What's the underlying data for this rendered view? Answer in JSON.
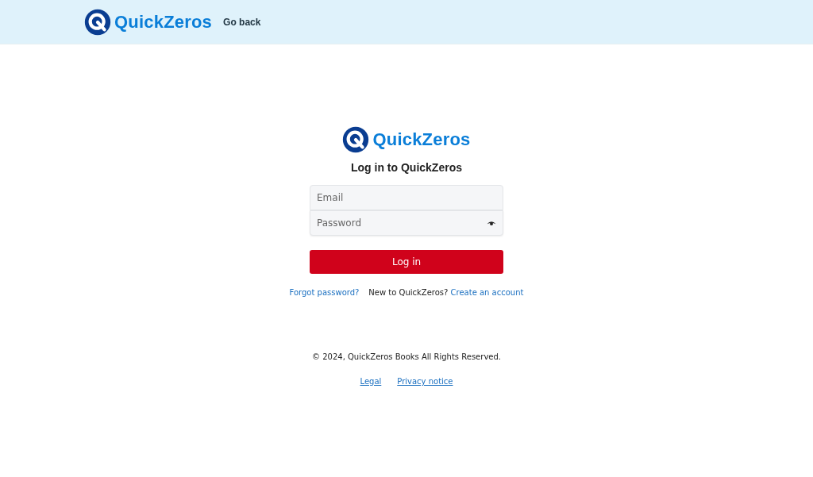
{
  "header": {
    "brand": "QuickZeros",
    "back_link": "Go back"
  },
  "login": {
    "brand": "QuickZeros",
    "title": "Log in to QuickZeros",
    "fields": [
      {
        "kind": "email",
        "placeholder": "Email"
      },
      {
        "kind": "password",
        "placeholder": "Password"
      }
    ],
    "submit": "Log in",
    "forgot_link": "Forgot password?",
    "signup_prompt": "New to QuickZeros?",
    "signup_link": "Create an account"
  },
  "footer": {
    "copyright": "© 2024, QuickZeros Books All Rights Reserved.",
    "links": [
      "Legal",
      "Privacy notice"
    ]
  }
}
